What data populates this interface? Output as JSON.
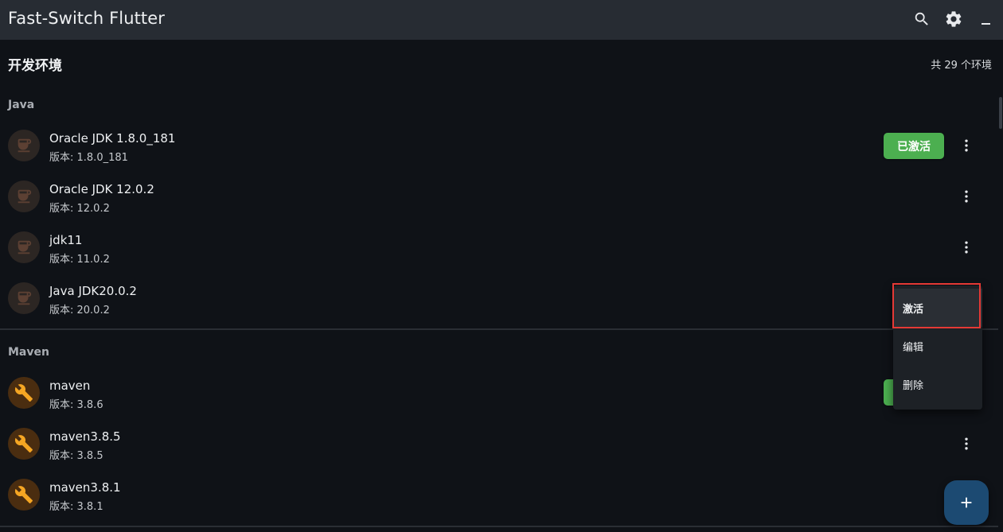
{
  "app": {
    "title": "Fast-Switch Flutter"
  },
  "appbar": {
    "icons": [
      "search-icon",
      "settings-icon",
      "minimize-icon"
    ]
  },
  "header": {
    "title": "开发环境",
    "count": "共 29 个环境"
  },
  "sections": {
    "java": {
      "title": "Java",
      "items": [
        {
          "name": "Oracle JDK 1.8.0_181",
          "version": "版本: 1.8.0_181",
          "active": true
        },
        {
          "name": "Oracle JDK 12.0.2",
          "version": "版本: 12.0.2",
          "active": false
        },
        {
          "name": "jdk11",
          "version": "版本: 11.0.2",
          "active": false
        },
        {
          "name": "Java JDK20.0.2",
          "version": "版本: 20.0.2",
          "active": false
        }
      ]
    },
    "maven": {
      "title": "Maven",
      "items": [
        {
          "name": "maven",
          "version": "版本: 3.8.6",
          "active": true
        },
        {
          "name": "maven3.8.5",
          "version": "版本: 3.8.5",
          "active": false
        },
        {
          "name": "maven3.8.1",
          "version": "版本: 3.8.1",
          "active": false
        }
      ]
    }
  },
  "labels": {
    "active_badge": "已激活"
  },
  "context_menu": {
    "items": [
      {
        "label": "激活",
        "highlighted": true
      },
      {
        "label": "编辑",
        "highlighted": false
      },
      {
        "label": "删除",
        "highlighted": false
      }
    ]
  },
  "fab": {
    "icon": "add-icon"
  },
  "colors": {
    "appbar": "#272c33",
    "background": "#0f1217",
    "active_green": "#4caf50",
    "fab_blue": "#1c4a72",
    "focus_red": "#e53935",
    "maven_icon": "#f5a623"
  }
}
